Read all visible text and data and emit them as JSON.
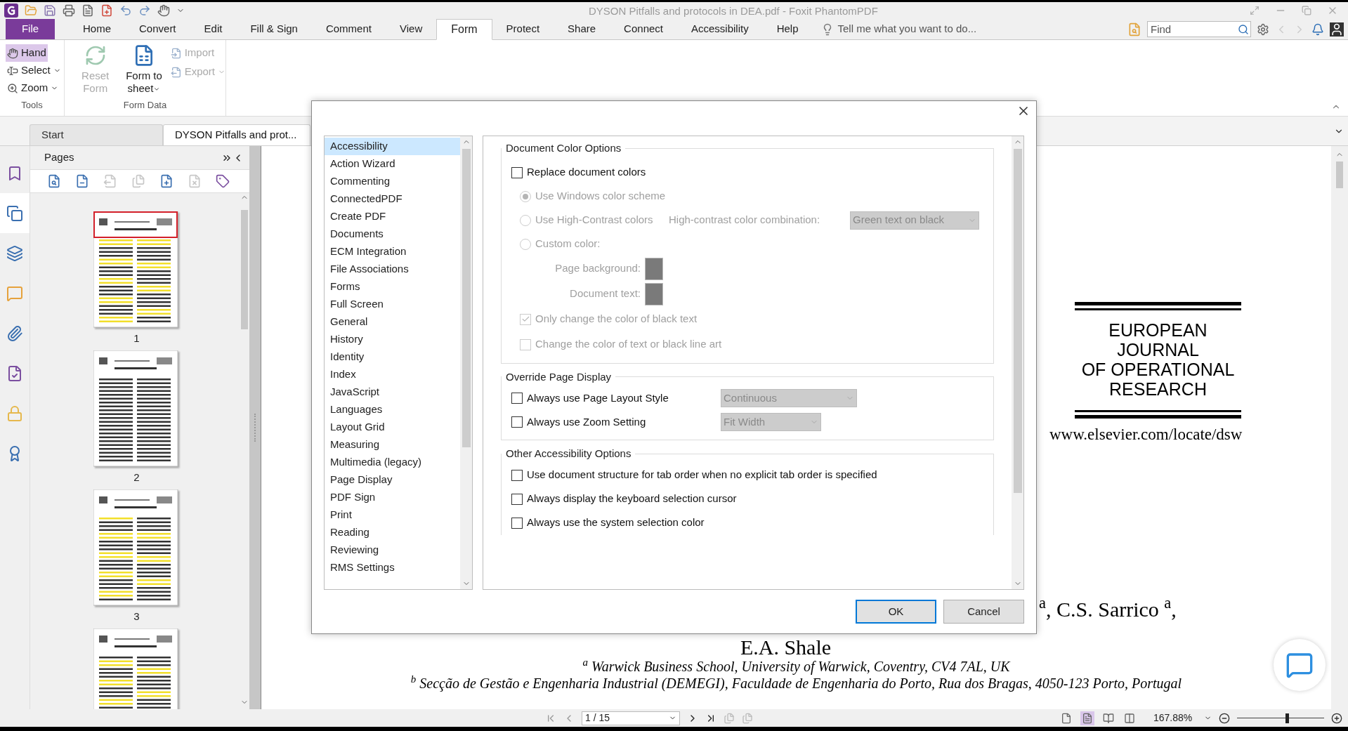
{
  "window": {
    "title": "DYSON Pitfalls and protocols in DEA.pdf - Foxit PhantomPDF"
  },
  "menu_tabs": [
    {
      "label": "File",
      "kind": "file",
      "selected": false
    },
    {
      "label": "Home",
      "kind": "tab",
      "selected": false
    },
    {
      "label": "Convert",
      "kind": "tab",
      "selected": false
    },
    {
      "label": "Edit",
      "kind": "tab",
      "selected": false
    },
    {
      "label": "Fill & Sign",
      "kind": "tab",
      "selected": false
    },
    {
      "label": "Comment",
      "kind": "tab",
      "selected": false
    },
    {
      "label": "View",
      "kind": "tab",
      "selected": false
    },
    {
      "label": "Form",
      "kind": "tab",
      "selected": true
    },
    {
      "label": "Protect",
      "kind": "tab",
      "selected": false
    },
    {
      "label": "Share",
      "kind": "tab",
      "selected": false
    },
    {
      "label": "Connect",
      "kind": "tab",
      "selected": false
    },
    {
      "label": "Accessibility",
      "kind": "tab",
      "selected": false
    },
    {
      "label": "Help",
      "kind": "tab",
      "selected": false
    }
  ],
  "tell_me": {
    "placeholder": "Tell me what you want to do..."
  },
  "find": {
    "placeholder": "Find"
  },
  "ribbon": {
    "tools": {
      "label": "Tools",
      "items": [
        {
          "kind": "hand",
          "label": "Hand",
          "selected": true,
          "dropdown": false
        },
        {
          "kind": "select",
          "label": "Select",
          "selected": false,
          "dropdown": true
        },
        {
          "kind": "zoom",
          "label": "Zoom",
          "selected": false,
          "dropdown": true
        }
      ]
    },
    "form_data": {
      "label": "Form Data",
      "buttons": [
        {
          "kind": "reset",
          "label": "Reset Form",
          "disabled": true,
          "dropdown": false
        },
        {
          "kind": "sheet",
          "label": "Form to sheet",
          "disabled": false,
          "dropdown": true
        }
      ],
      "small_buttons": [
        {
          "kind": "import",
          "label": "Import",
          "disabled": true,
          "dropdown": false
        },
        {
          "kind": "export",
          "label": "Export",
          "disabled": true,
          "dropdown": true
        }
      ]
    }
  },
  "doc_tabs": [
    {
      "label": "Start",
      "selected": false
    },
    {
      "label": "DYSON Pitfalls and prot...",
      "selected": true
    }
  ],
  "sidebar_tabs": [
    {
      "kind": "bookmarks",
      "selected": false
    },
    {
      "kind": "pages",
      "selected": true
    },
    {
      "kind": "layers",
      "selected": false
    },
    {
      "kind": "comments",
      "selected": false
    },
    {
      "kind": "attachments",
      "selected": false
    },
    {
      "kind": "signatures",
      "selected": false
    },
    {
      "kind": "security",
      "selected": false
    },
    {
      "kind": "certify",
      "selected": false
    }
  ],
  "pages_panel": {
    "title": "Pages",
    "tools": [
      {
        "kind": "zoom-in",
        "disabled": false
      },
      {
        "kind": "zoom-out",
        "disabled": false
      },
      {
        "kind": "extract",
        "disabled": true
      },
      {
        "kind": "replace",
        "disabled": true
      },
      {
        "kind": "insert",
        "disabled": false
      },
      {
        "kind": "delete",
        "disabled": true
      },
      {
        "kind": "label",
        "disabled": false
      }
    ],
    "thumbnails": [
      {
        "label": "1",
        "selected": true
      },
      {
        "label": "2",
        "selected": false
      },
      {
        "label": "3",
        "selected": false
      },
      {
        "selected": false
      }
    ]
  },
  "document": {
    "journal": [
      "EUROPEAN",
      "JOURNAL",
      "OF OPERATIONAL",
      "RESEARCH"
    ],
    "url": "www.elsevier.com/locate/dsw",
    "authors": "$^{a}$, C.S. Sarrico $^{a}$,",
    "authors_line2": "E.A. Shale",
    "affiliations": [
      "$^{a}$ Warwick Business School, University of Warwick, Coventry, CV4 7AL, UK",
      "$^{b}$ Secção de Gestão e Engenharia Industrial (DEMEGI), Faculdade de Engenharia do Porto, Rua dos Bragas, 4050-123 Porto, Portugal"
    ]
  },
  "dialog": {
    "categories": [
      {
        "label": "Accessibility",
        "selected": true
      },
      {
        "label": "Action Wizard",
        "selected": false
      },
      {
        "label": "Commenting",
        "selected": false
      },
      {
        "label": "ConnectedPDF",
        "selected": false
      },
      {
        "label": "Create PDF",
        "selected": false
      },
      {
        "label": "Documents",
        "selected": false
      },
      {
        "label": "ECM Integration",
        "selected": false
      },
      {
        "label": "File Associations",
        "selected": false
      },
      {
        "label": "Forms",
        "selected": false
      },
      {
        "label": "Full Screen",
        "selected": false
      },
      {
        "label": "General",
        "selected": false
      },
      {
        "label": "History",
        "selected": false
      },
      {
        "label": "Identity",
        "selected": false
      },
      {
        "label": "Index",
        "selected": false
      },
      {
        "label": "JavaScript",
        "selected": false
      },
      {
        "label": "Languages",
        "selected": false
      },
      {
        "label": "Layout Grid",
        "selected": false
      },
      {
        "label": "Measuring",
        "selected": false
      },
      {
        "label": "Multimedia (legacy)",
        "selected": false
      },
      {
        "label": "Page Display",
        "selected": false
      },
      {
        "label": "PDF Sign",
        "selected": false
      },
      {
        "label": "Print",
        "selected": false
      },
      {
        "label": "Reading",
        "selected": false
      },
      {
        "label": "Reviewing",
        "selected": false
      },
      {
        "label": "RMS Settings",
        "selected": false
      }
    ],
    "sections": [
      {
        "title": "Document Color Options",
        "options": [
          {
            "kind": "checkbox",
            "label": "Replace document colors",
            "checked": false,
            "disabled": false
          },
          {
            "kind": "radio",
            "label": "Use Windows color scheme",
            "selected": true,
            "disabled": true
          },
          {
            "kind": "radio",
            "label": "Use High-Contrast colors",
            "selected": false,
            "disabled": true,
            "combo_label": "High-contrast color combination:",
            "combo_value": "Green text on black"
          },
          {
            "kind": "radio",
            "label": "Custom color:",
            "selected": false,
            "disabled": true
          },
          {
            "kind": "swatch",
            "label": "Page background:"
          },
          {
            "kind": "swatch",
            "label": "Document text:"
          },
          {
            "kind": "subcheckbox",
            "label": "Only change the color of black text",
            "checked": true,
            "disabled": true
          },
          {
            "kind": "subcheckbox",
            "label": "Change the color of text or black line art",
            "checked": false,
            "disabled": true
          }
        ]
      },
      {
        "title": "Override Page Display",
        "options": [
          {
            "kind": "checkbox",
            "label": "Always use Page Layout Style",
            "checked": false,
            "disabled": false,
            "combo_value": "Continuous"
          },
          {
            "kind": "checkbox",
            "label": "Always use Zoom Setting",
            "checked": false,
            "disabled": false,
            "combo_value": "Fit Width"
          }
        ]
      },
      {
        "title": "Other Accessibility Options",
        "options": [
          {
            "kind": "checkbox",
            "label": "Use document structure for tab order when no explicit tab order is specified",
            "checked": false,
            "disabled": false
          },
          {
            "kind": "checkbox",
            "label": "Always display the keyboard selection cursor",
            "checked": false,
            "disabled": false
          },
          {
            "kind": "checkbox",
            "label": "Always use the system selection color",
            "checked": false,
            "disabled": false
          }
        ]
      }
    ],
    "buttons": [
      {
        "label": "OK",
        "default": true
      },
      {
        "label": "Cancel",
        "default": false
      }
    ]
  },
  "status_bar": {
    "page": "1 / 15",
    "zoom": "167.88%",
    "level": 0.57,
    "view_modes": [
      {
        "kind": "single",
        "selected": false
      },
      {
        "kind": "continuous",
        "selected": true
      },
      {
        "kind": "facing",
        "selected": false
      },
      {
        "kind": "cont-facing",
        "selected": false
      }
    ]
  }
}
